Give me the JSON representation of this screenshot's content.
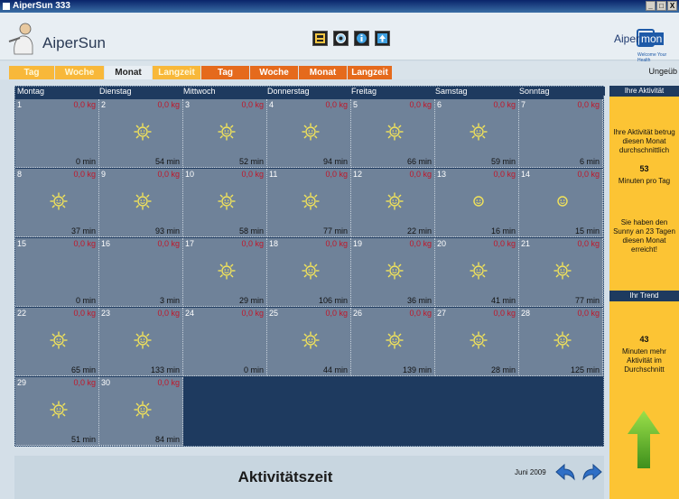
{
  "window": {
    "title": "AiperSun 333",
    "controls": [
      "_",
      "□",
      "X"
    ]
  },
  "header": {
    "app_name": "AiperSun",
    "brand_left": "Aiper",
    "brand_right": "mon",
    "brand_tagline": "Welcome Your Health",
    "icons": [
      "print-icon",
      "settings-icon",
      "info-icon",
      "upload-icon"
    ]
  },
  "tabs": [
    {
      "label": "Tag",
      "style": "yellow"
    },
    {
      "label": "Woche",
      "style": "yellow"
    },
    {
      "label": "Monat",
      "style": "active"
    },
    {
      "label": "Langzeit",
      "style": "yellow"
    },
    {
      "label": "Tag",
      "style": "orange"
    },
    {
      "label": "Woche",
      "style": "orange"
    },
    {
      "label": "Monat",
      "style": "orange"
    },
    {
      "label": "Langzeit",
      "style": "orange"
    }
  ],
  "right_label": "Ungeüb",
  "calendar": {
    "weekdays": [
      "Montag",
      "Dienstag",
      "Mittwoch",
      "Donnerstag",
      "Freitag",
      "Samstag",
      "Sonntag"
    ],
    "days": [
      {
        "day": "1",
        "kg": "0,0 kg",
        "min": "0 min",
        "icon": "none"
      },
      {
        "day": "2",
        "kg": "0,0 kg",
        "min": "54 min",
        "icon": "sun-icon"
      },
      {
        "day": "3",
        "kg": "0,0 kg",
        "min": "52 min",
        "icon": "sun-icon"
      },
      {
        "day": "4",
        "kg": "0,0 kg",
        "min": "94 min",
        "icon": "sun-icon"
      },
      {
        "day": "5",
        "kg": "0,0 kg",
        "min": "66 min",
        "icon": "sun-icon"
      },
      {
        "day": "6",
        "kg": "0,0 kg",
        "min": "59 min",
        "icon": "sun-icon"
      },
      {
        "day": "7",
        "kg": "0,0 kg",
        "min": "6 min",
        "icon": "none"
      },
      {
        "day": "8",
        "kg": "0,0 kg",
        "min": "37 min",
        "icon": "sun-icon"
      },
      {
        "day": "9",
        "kg": "0,0 kg",
        "min": "93 min",
        "icon": "sun-icon"
      },
      {
        "day": "10",
        "kg": "0,0 kg",
        "min": "58 min",
        "icon": "sun-icon"
      },
      {
        "day": "11",
        "kg": "0,0 kg",
        "min": "77 min",
        "icon": "sun-icon"
      },
      {
        "day": "12",
        "kg": "0,0 kg",
        "min": "22 min",
        "icon": "sun-icon"
      },
      {
        "day": "13",
        "kg": "0,0 kg",
        "min": "16 min",
        "icon": "smiley-icon"
      },
      {
        "day": "14",
        "kg": "0,0 kg",
        "min": "15 min",
        "icon": "smiley-icon"
      },
      {
        "day": "15",
        "kg": "0,0 kg",
        "min": "0 min",
        "icon": "none"
      },
      {
        "day": "16",
        "kg": "0,0 kg",
        "min": "3 min",
        "icon": "none"
      },
      {
        "day": "17",
        "kg": "0,0 kg",
        "min": "29 min",
        "icon": "sun-icon"
      },
      {
        "day": "18",
        "kg": "0,0 kg",
        "min": "106 min",
        "icon": "sun-icon"
      },
      {
        "day": "19",
        "kg": "0,0 kg",
        "min": "36 min",
        "icon": "sun-icon"
      },
      {
        "day": "20",
        "kg": "0,0 kg",
        "min": "41 min",
        "icon": "sun-icon"
      },
      {
        "day": "21",
        "kg": "0,0 kg",
        "min": "77 min",
        "icon": "sun-icon"
      },
      {
        "day": "22",
        "kg": "0,0 kg",
        "min": "65 min",
        "icon": "sun-icon"
      },
      {
        "day": "23",
        "kg": "0,0 kg",
        "min": "133 min",
        "icon": "sun-icon"
      },
      {
        "day": "24",
        "kg": "0,0 kg",
        "min": "0 min",
        "icon": "none"
      },
      {
        "day": "25",
        "kg": "0,0 kg",
        "min": "44 min",
        "icon": "sun-icon"
      },
      {
        "day": "26",
        "kg": "0,0 kg",
        "min": "139 min",
        "icon": "sun-icon"
      },
      {
        "day": "27",
        "kg": "0,0 kg",
        "min": "28 min",
        "icon": "sun-icon"
      },
      {
        "day": "28",
        "kg": "0,0 kg",
        "min": "125 min",
        "icon": "sun-icon"
      },
      {
        "day": "29",
        "kg": "0,0 kg",
        "min": "51 min",
        "icon": "sun-icon"
      },
      {
        "day": "30",
        "kg": "0,0 kg",
        "min": "84 min",
        "icon": "sun-icon"
      }
    ]
  },
  "footer": {
    "caption": "Aktivitätszeit",
    "month_year": "Juni 2009",
    "prev_icon": "back-arrow-icon",
    "next_icon": "forward-arrow-icon"
  },
  "side": {
    "activity_header": "Ihre Aktivität",
    "activity_text": "Ihre Aktivität betrug diesen Monat durchschnittlich",
    "activity_value": "53",
    "activity_unit": "Minuten pro Tag",
    "sunny_text": "Sie haben den Sunny an 23 Tagen diesen Monat erreicht!",
    "trend_header": "Ihr Trend",
    "trend_value": "43",
    "trend_text": "Minuten mehr Aktivität im Durchschnitt",
    "trend_icon": "up-arrow-icon"
  },
  "colors": {
    "calendar_bg": "#1e3a5f",
    "cell_bg": "#6f8299",
    "kg_text": "#c0182a",
    "side_panel": "#fcc434",
    "tab_yellow": "#f8b83a",
    "tab_orange": "#e56a1c"
  }
}
